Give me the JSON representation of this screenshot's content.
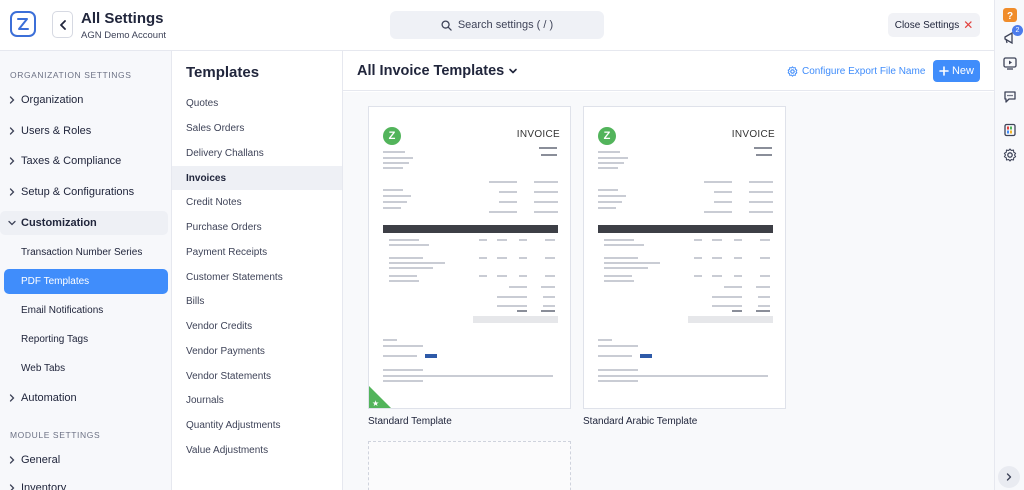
{
  "header": {
    "title": "All Settings",
    "subtitle": "AGN Demo Account",
    "search_placeholder": "Search settings ( / )",
    "close_label": "Close Settings"
  },
  "rail": {
    "notification_count": "2"
  },
  "sidebar": {
    "org_section": "ORGANIZATION SETTINGS",
    "items": [
      {
        "label": "Organization"
      },
      {
        "label": "Users & Roles"
      },
      {
        "label": "Taxes & Compliance"
      },
      {
        "label": "Setup & Configurations"
      },
      {
        "label": "Customization"
      }
    ],
    "sub_items": [
      {
        "label": "Transaction Number Series"
      },
      {
        "label": "PDF Templates"
      },
      {
        "label": "Email Notifications"
      },
      {
        "label": "Reporting Tags"
      },
      {
        "label": "Web Tabs"
      }
    ],
    "automation": "Automation",
    "module_section": "MODULE SETTINGS",
    "module_items": [
      {
        "label": "General"
      },
      {
        "label": "Inventory"
      }
    ]
  },
  "templates": {
    "heading": "Templates",
    "items": [
      {
        "label": "Quotes"
      },
      {
        "label": "Sales Orders"
      },
      {
        "label": "Delivery Challans"
      },
      {
        "label": "Invoices"
      },
      {
        "label": "Credit Notes"
      },
      {
        "label": "Purchase Orders"
      },
      {
        "label": "Payment Receipts"
      },
      {
        "label": "Customer Statements"
      },
      {
        "label": "Bills"
      },
      {
        "label": "Vendor Credits"
      },
      {
        "label": "Vendor Payments"
      },
      {
        "label": "Vendor Statements"
      },
      {
        "label": "Journals"
      },
      {
        "label": "Quantity Adjustments"
      },
      {
        "label": "Value Adjustments"
      }
    ]
  },
  "main": {
    "title": "All Invoice Templates",
    "configure_label": "Configure Export File Name",
    "new_label": "New",
    "cards": [
      {
        "name": "Standard Template",
        "preview_title": "INVOICE"
      },
      {
        "name": "Standard Arabic Template",
        "preview_title": "INVOICE"
      }
    ]
  },
  "colors": {
    "accent": "#408dfb",
    "brand_green": "#52b45b",
    "close_red": "#e2413d"
  }
}
